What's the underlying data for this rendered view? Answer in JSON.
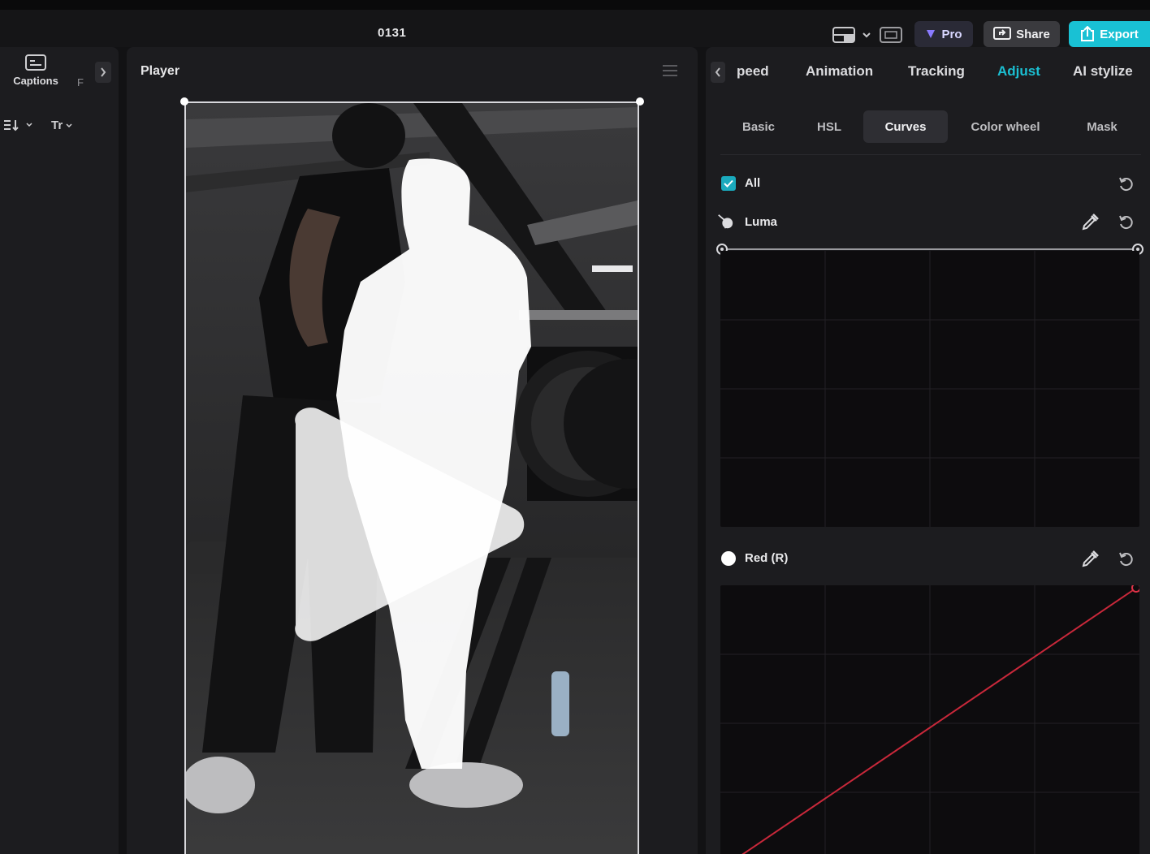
{
  "app": {
    "project_title": "0131",
    "pro_label": "Pro",
    "share_label": "Share",
    "export_label": "Export"
  },
  "left_panel": {
    "captions_label": "Captions",
    "next_tab_partial": "F",
    "font_tool": "Tr"
  },
  "player": {
    "title": "Player"
  },
  "inspector": {
    "tabs": [
      {
        "label": "Speed",
        "visible_text": "peed"
      },
      {
        "label": "Animation"
      },
      {
        "label": "Tracking"
      },
      {
        "label": "Adjust",
        "active": true
      },
      {
        "label": "AI stylize"
      }
    ],
    "subtabs": [
      {
        "label": "Basic"
      },
      {
        "label": "HSL"
      },
      {
        "label": "Curves",
        "active": true
      },
      {
        "label": "Color wheel"
      },
      {
        "label": "Mask"
      }
    ],
    "all_label": "All",
    "all_checked": true,
    "luma_label": "Luma",
    "red_label": "Red (R)",
    "red_curve_color": "#c8283a",
    "accent_color": "#19c1d4"
  },
  "icons": [
    "layout-icon",
    "dropdown-icon",
    "captions-icon",
    "pro-badge-icon",
    "share-icon",
    "export-icon",
    "chevron-right-icon",
    "chevron-left-icon",
    "sort-icon",
    "menu-icon",
    "play-icon",
    "reset-icon",
    "eyedropper-icon",
    "channel-icon"
  ]
}
